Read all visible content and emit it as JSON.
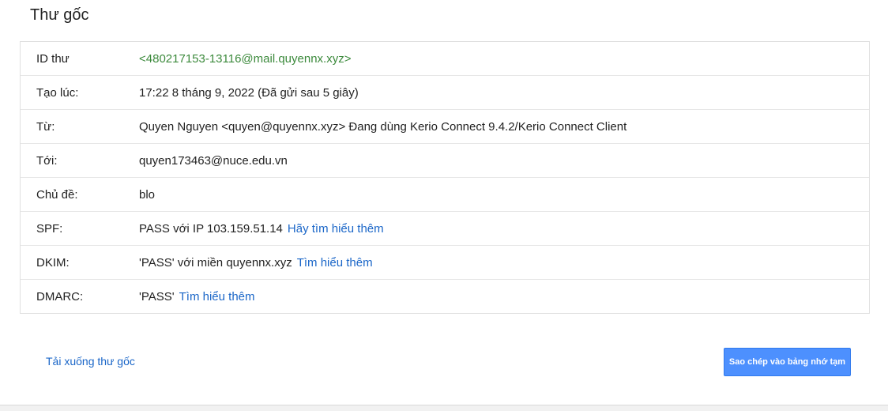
{
  "page": {
    "title": "Thư gốc"
  },
  "details": {
    "rows": [
      {
        "label": "ID thư",
        "value": "<480217153-13116@mail.quyennx.xyz>",
        "link": ""
      },
      {
        "label": "Tạo lúc:",
        "value": "17:22 8 tháng 9, 2022 (Đã gửi sau 5 giây)",
        "link": ""
      },
      {
        "label": "Từ:",
        "value": "Quyen Nguyen <quyen@quyennx.xyz> Đang dùng Kerio Connect 9.4.2/Kerio Connect Client",
        "link": ""
      },
      {
        "label": "Tới:",
        "value": "quyen173463@nuce.edu.vn",
        "link": ""
      },
      {
        "label": "Chủ đề:",
        "value": "blo",
        "link": ""
      },
      {
        "label": "SPF:",
        "value": "PASS với IP 103.159.51.14",
        "link": "Hãy tìm hiểu thêm"
      },
      {
        "label": "DKIM:",
        "value": "'PASS' với miền quyennx.xyz",
        "link": "Tìm hiểu thêm"
      },
      {
        "label": "DMARC:",
        "value": "'PASS'",
        "link": "Tìm hiểu thêm"
      }
    ]
  },
  "actions": {
    "download_label": "Tải xuống thư gốc",
    "copy_label": "Sao chép vào bảng nhớ tạm"
  },
  "colors": {
    "message_id": "#3c8a3c",
    "link": "#1a66c8",
    "primary_button": "#4d90fe"
  }
}
